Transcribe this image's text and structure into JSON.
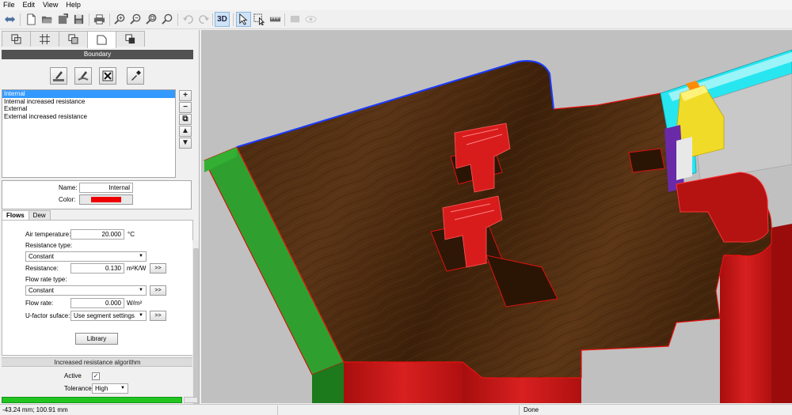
{
  "menu": [
    "File",
    "Edit",
    "View",
    "Help"
  ],
  "toolbar": {
    "view3d_label": "3D"
  },
  "panel": {
    "section_title": "Boundary",
    "boundary_list": [
      "Internal",
      "Internal increased resistance",
      "External",
      "External increased resistance"
    ],
    "selected_index": 0,
    "name_label": "Name:",
    "name_value": "Internal",
    "color_label": "Color:",
    "color_value": "#ee0000",
    "sub_tabs": [
      "Flows",
      "Dew"
    ],
    "air_temp_label": "Air temperature:",
    "air_temp_value": "20.000",
    "air_temp_unit": "°C",
    "resistance_type_label": "Resistance type:",
    "resistance_type_value": "Constant",
    "resistance_label": "Resistance:",
    "resistance_value": "0.130",
    "resistance_unit": "m²K/W",
    "flow_rate_type_label": "Flow rate type:",
    "flow_rate_type_value": "Constant",
    "flow_rate_label": "Flow rate:",
    "flow_rate_value": "0.000",
    "flow_rate_unit": "W/m²",
    "ufactor_label": "U-factor suface:",
    "ufactor_value": "Use segment settings",
    "more_label": ">>",
    "library_label": "Library",
    "algo_title": "Increased resistance algorithm",
    "active_label": "Active",
    "active_checked": "✓",
    "tolerance_label": "Tolerance",
    "tolerance_value": "High",
    "progress": 0.92
  },
  "side_buttons": [
    "+",
    "−",
    "⧉",
    "▲",
    "▼"
  ],
  "status": {
    "coords": "-43.24 mm; 100.91 mm",
    "message": "Done"
  },
  "colors": {
    "wood": "#4a2a10",
    "insulation_red": "#d01a1a",
    "seal_green": "#1f8a1f",
    "glass_cyan": "#28e6f0",
    "gasket_yellow": "#f0dc28"
  }
}
